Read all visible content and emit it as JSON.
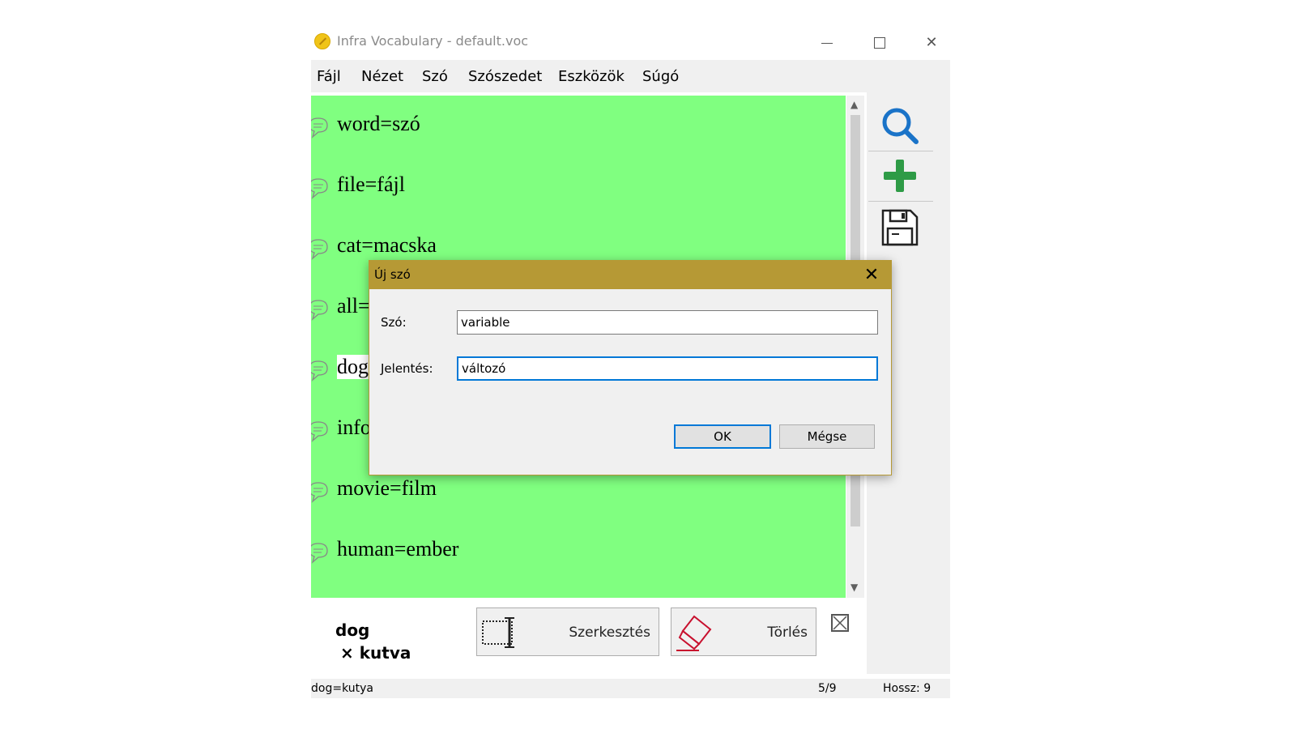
{
  "window": {
    "title": "Infra Vocabulary - default.voc",
    "controls": {
      "minimize": "minimize-icon",
      "maximize": "maximize-icon",
      "close": "close-icon"
    }
  },
  "menu": [
    "Fájl",
    "Nézet",
    "Szó",
    "Szószedet",
    "Eszközök",
    "Súgó"
  ],
  "entries": [
    "word=szó",
    "file=fájl",
    "cat=macska",
    "all=",
    "dog",
    "info",
    "movie=film",
    "human=ember"
  ],
  "selected_index": 4,
  "toolbar": {
    "search": "search-icon",
    "add": "plus-icon",
    "save": "floppy-disk-icon"
  },
  "bottom": {
    "word": "dog",
    "meaning": "× kutva",
    "edit_label": "Szerkesztés",
    "delete_label": "Törlés"
  },
  "status": {
    "text": "dog=kutya",
    "position": "5/9",
    "length": "Hossz: 9"
  },
  "dialog": {
    "title": "Új szó",
    "word_label": "Szó:",
    "word_value": "variable",
    "meaning_label": "Jelentés:",
    "meaning_value": "változó",
    "ok_label": "OK",
    "cancel_label": "Mégse"
  },
  "colors": {
    "list_bg": "#80ff80",
    "dialog_title": "#b69935",
    "focus": "#0078d7",
    "search": "#1a73c8",
    "add": "#2e9b46"
  }
}
